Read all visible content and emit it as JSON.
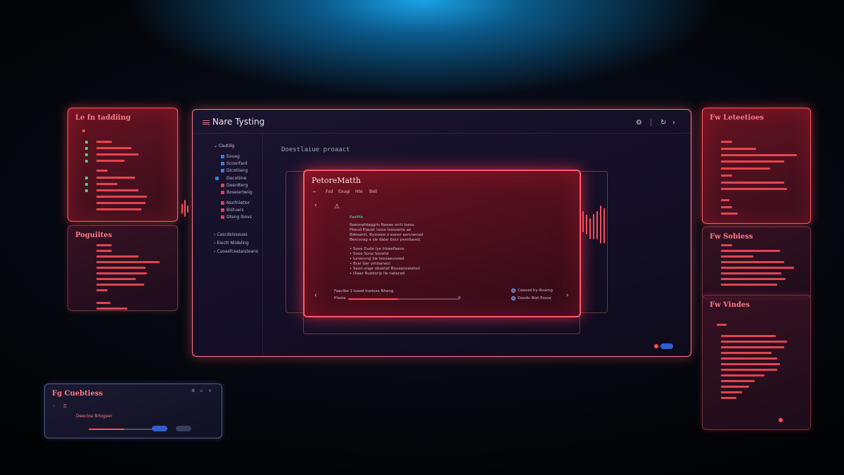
{
  "main_window": {
    "title": "Nare Tysting",
    "content_heading": "Doestlaiue proaact",
    "toolbar_icons": [
      "settings-icon",
      "refresh-icon",
      "forward-icon"
    ],
    "sidebar": {
      "section1_header": "Csutiilg",
      "items": [
        "Eouag",
        "Scosnfard",
        "Dicotiieng",
        "Decotiine",
        "Deerdterg",
        "Boseiertwiig",
        "Nsnfriietlor",
        "Bistuars",
        "Dteng Ibovs"
      ],
      "section2": [
        "Cascdsisseuas",
        "Eiectt Nlideling",
        "Cuoasfceataisteans"
      ]
    }
  },
  "dialog": {
    "title": "PetoreMatth",
    "menu": [
      "Fsd",
      "Exugi",
      "Hte",
      "Bell"
    ],
    "heading": "Paslfile",
    "body": [
      "Reeonafdaggrls Neeee srcti loess",
      "Pbeud Elauet losse leosserte ae",
      "Bdeaarst, Bysseee o eanar aarcoenad",
      "Bexcerag a sle dalar bocr pessliared."
    ],
    "bullets": [
      "Sooe Dude lye Irlseeflaess",
      "Sooe Sone Sonetd",
      "Iuneovng Ise leovaeuroied",
      "Bcel Ger ymlsanecl",
      "Seon-snge oboetat Boueeceaiated",
      "Oiaer Ruddorip lle nataced"
    ],
    "footer_label": "Faeclbe 1 lsaed lcedsse Nheng",
    "progress_label": "Plaste",
    "progress_value": 0.45,
    "options": [
      "Ceessd Iry-Rvamg",
      "Oexdo Blat Eosse"
    ]
  },
  "panels": {
    "left_top": "Le fn taddiing",
    "left_bottom": "Poguiites",
    "right_top": "Fw Leteetioes",
    "right_middle": "Fw Sobiess",
    "right_bottom": "Fw Vindes",
    "bottom_left": "Fg Cuebtiess"
  },
  "widget": {
    "subtitle": "Deecloa Brlogeer",
    "progress_value": 0.55
  },
  "colors": {
    "accent_red": "#ff4f5c",
    "accent_blue": "#1aa3e6",
    "bg": "#05070d"
  }
}
